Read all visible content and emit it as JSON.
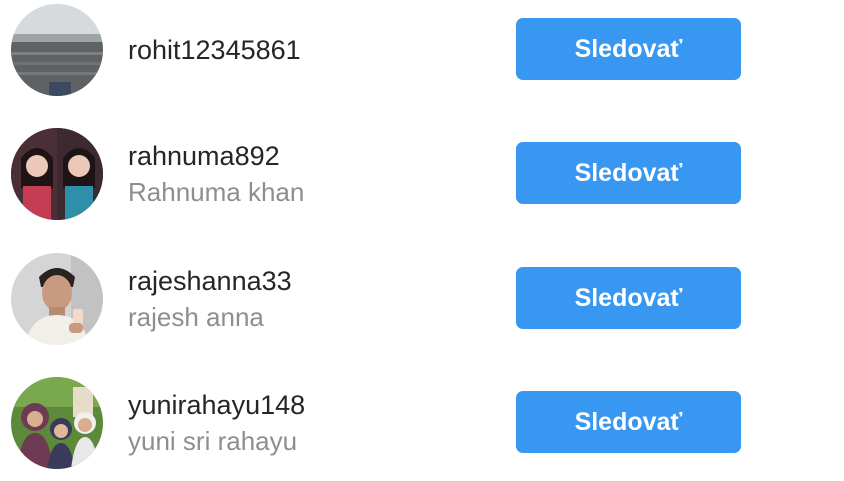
{
  "accent_color": "#3897f0",
  "suggestions": [
    {
      "username": "rohit12345861",
      "full_name": "",
      "follow_label": "Sledovať",
      "avatar": "lake-photo"
    },
    {
      "username": "rahnuma892",
      "full_name": "Rahnuma khan",
      "follow_label": "Sledovať",
      "avatar": "selfie-collage"
    },
    {
      "username": "rajeshanna33",
      "full_name": "rajesh anna",
      "follow_label": "Sledovať",
      "avatar": "mirror-selfie"
    },
    {
      "username": "yunirahayu148",
      "full_name": "yuni sri rahayu",
      "follow_label": "Sledovať",
      "avatar": "group-photo"
    }
  ]
}
